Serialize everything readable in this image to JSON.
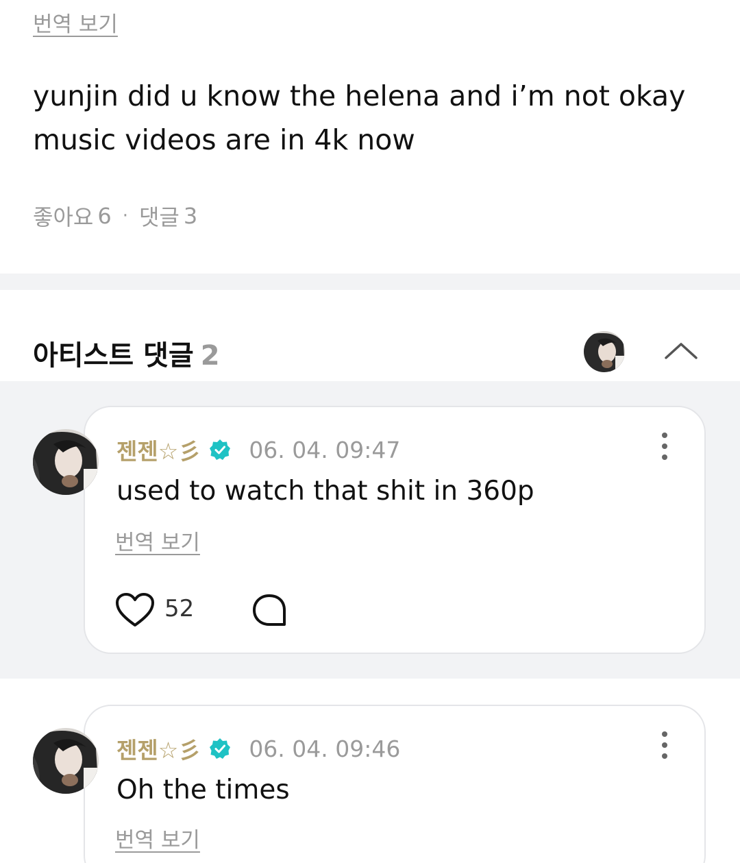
{
  "post": {
    "translate_label": "번역 보기",
    "body": "yunjin did u know the helena and i’m not okay music videos are in 4k now",
    "likes_label": "좋아요",
    "likes_count": "6",
    "separator": "·",
    "comments_label": "댓글",
    "comments_count": "3"
  },
  "artist_comments": {
    "title": "아티스트 댓글",
    "count": "2"
  },
  "comments": [
    {
      "author": "젠젠☆彡",
      "time": "06. 04. 09:47",
      "text": "used to watch that shit in 360p",
      "translate_label": "번역 보기",
      "likes": "52"
    },
    {
      "author": "젠젠☆彡",
      "time": "06. 04. 09:46",
      "text": "Oh the times",
      "translate_label": "번역 보기"
    }
  ],
  "colors": {
    "accent_gold": "#b5a06a",
    "verified_teal": "#1fc2c4",
    "muted_gray": "#9a9a9a",
    "band_gray": "#f2f3f5"
  },
  "icons": [
    "verified-icon",
    "more-vertical-icon",
    "heart-icon",
    "reply-bubble-icon",
    "chevron-up-icon"
  ]
}
